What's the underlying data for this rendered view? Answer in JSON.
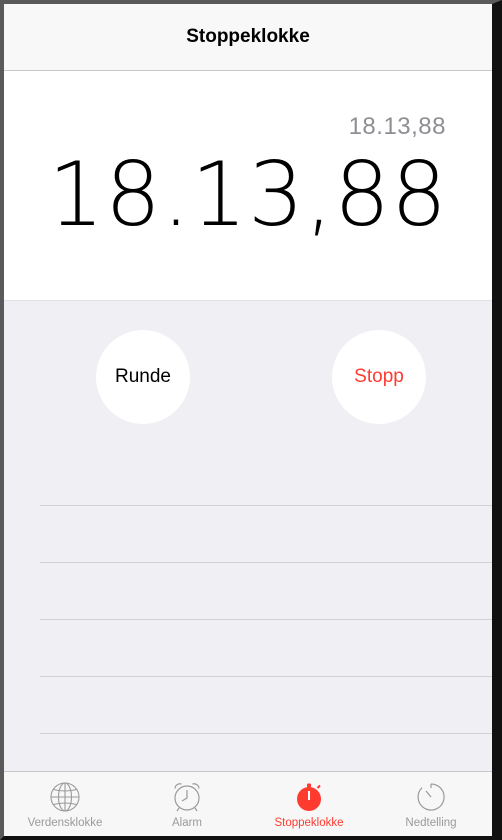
{
  "navbar": {
    "title": "Stoppeklokke"
  },
  "stopwatch": {
    "lap_time": "18.13,88",
    "main_time": "18.13,88"
  },
  "buttons": {
    "lap_label": "Runde",
    "stop_label": "Stopp"
  },
  "lap_rows": 5,
  "tabbar": {
    "active": "Stoppeklokke",
    "tabs": [
      {
        "label": "Verdensklokke",
        "icon": "globe-icon"
      },
      {
        "label": "Alarm",
        "icon": "alarm-clock-icon"
      },
      {
        "label": "Stoppeklokke",
        "icon": "stopwatch-icon"
      },
      {
        "label": "Nedtelling",
        "icon": "timer-icon"
      }
    ]
  },
  "colors": {
    "accent": "#ff3b30",
    "inactive_tab": "#9a9a9a",
    "controls_background": "#efeff4"
  }
}
